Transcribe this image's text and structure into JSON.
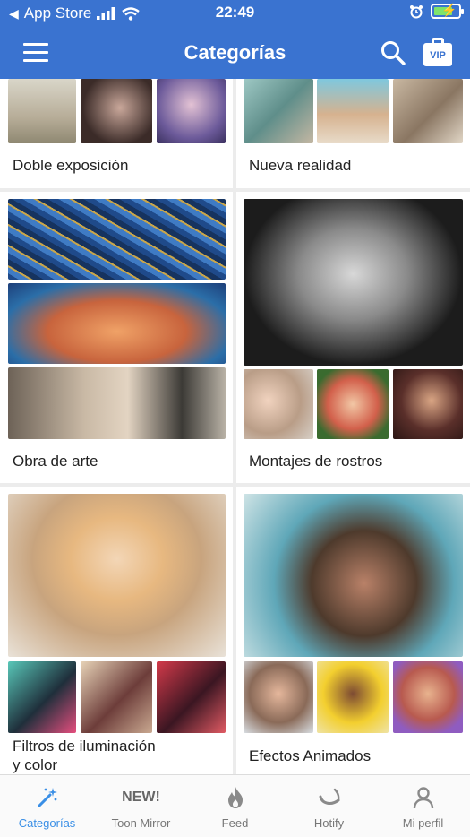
{
  "status_bar": {
    "back_app": "App Store",
    "time": "22:49"
  },
  "header": {
    "title": "Categorías",
    "vip_label": "VIP",
    "background": "#3a73d0"
  },
  "categories": [
    {
      "label": "Doble exposición"
    },
    {
      "label": "Nueva realidad"
    },
    {
      "label": "Obra de arte"
    },
    {
      "label": "Montajes de rostros"
    },
    {
      "label_line1": "Filtros de iluminación",
      "label_line2": "y color"
    },
    {
      "label": "Efectos Animados"
    }
  ],
  "tabbar": {
    "active_color": "#3a8fe6",
    "tabs": [
      {
        "label": "Categorías",
        "icon": "magic-wand-icon",
        "active": true
      },
      {
        "label": "Toon Mirror",
        "badge": "NEW!",
        "active": false
      },
      {
        "label": "Feed",
        "icon": "flame-icon",
        "active": false
      },
      {
        "label": "Hotify",
        "icon": "chili-icon",
        "active": false
      },
      {
        "label": "Mi perfil",
        "icon": "person-icon",
        "active": false
      }
    ]
  }
}
